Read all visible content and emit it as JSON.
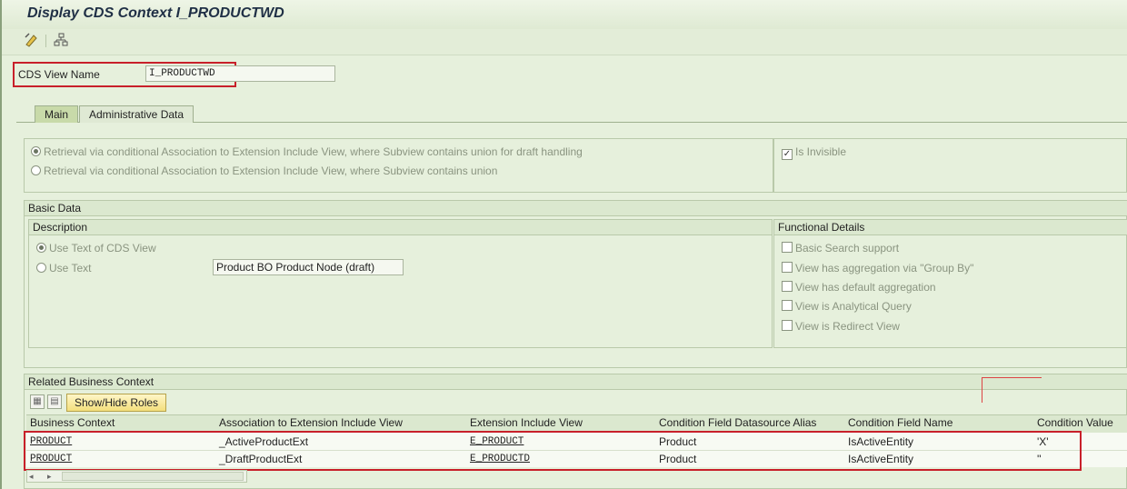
{
  "window": {
    "title": "Display CDS Context I_PRODUCTWD"
  },
  "toolbar": {
    "icons": [
      "edit-icon",
      "hierarchy-icon"
    ]
  },
  "header": {
    "cds_view_label": "CDS View Name",
    "cds_view_value": "I_PRODUCTWD"
  },
  "tabs": [
    {
      "label": "Main",
      "active": true
    },
    {
      "label": "Administrative Data",
      "active": false
    }
  ],
  "retrieval": {
    "option1": "Retrieval via conditional Association to Extension Include View, where Subview contains union for draft handling",
    "option2": "Retrieval via conditional Association to Extension Include View, where Subview contains union",
    "selected": 1,
    "is_invisible_label": "Is Invisible",
    "is_invisible_checked": true
  },
  "basic_data": {
    "title": "Basic Data",
    "description": {
      "title": "Description",
      "use_cds_text": "Use Text of CDS View",
      "use_text": "Use Text",
      "text_value": "Product BO Product Node (draft)"
    },
    "functional_details": {
      "title": "Functional Details",
      "items": [
        "Basic Search support",
        "View has aggregation via \"Group By\"",
        "View has default aggregation",
        "View is Analytical Query",
        "View is Redirect View"
      ]
    }
  },
  "related": {
    "title": "Related Business Context",
    "button": "Show/Hide Roles",
    "columns": [
      "Business Context",
      "Association to Extension Include View",
      "Extension Include View",
      "Condition Field Datasource Alias",
      "Condition Field Name",
      "Condition Value"
    ],
    "rows": [
      [
        "PRODUCT",
        "_ActiveProductExt",
        "E_PRODUCT",
        "Product",
        "IsActiveEntity",
        "'X'"
      ],
      [
        "PRODUCT",
        "_DraftProductExt",
        "E_PRODUCTD",
        "Product",
        "IsActiveEntity",
        "''"
      ]
    ]
  },
  "colors": {
    "highlight": "#c8202a",
    "background": "#e6f0dc",
    "title": "#1f2f45"
  }
}
